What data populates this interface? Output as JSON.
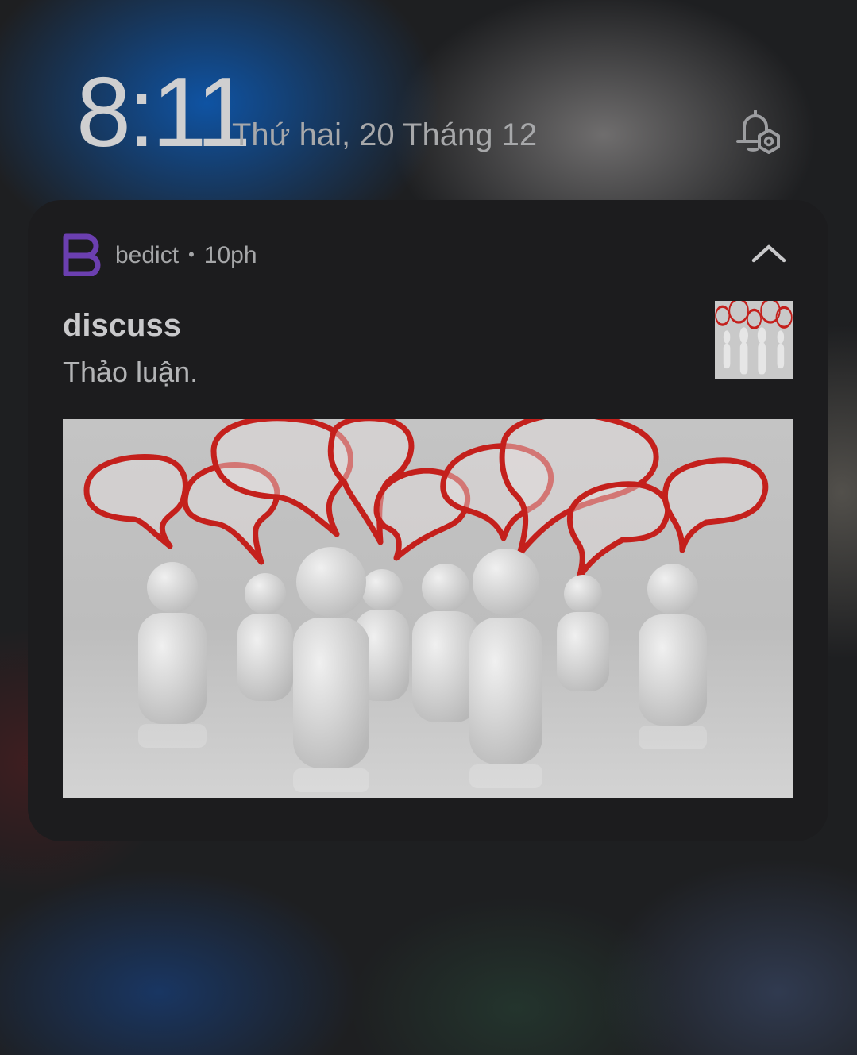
{
  "status": {
    "time": "8:11",
    "date": "Thứ hai, 20 Tháng 12",
    "alarm_icon": "alarm-settings-icon"
  },
  "notification": {
    "app_name": "bedict",
    "separator": "•",
    "time_ago": "10ph",
    "app_icon": "bedict-logo",
    "app_color": "#6b3fb0",
    "expand_icon": "chevron-up-icon",
    "title": "discuss",
    "text": "Thảo luận.",
    "thumbnail": "discussion-speech-bubbles-thumbnail",
    "image": "discussion-speech-bubbles-image",
    "bubble_color": "#c4201c"
  }
}
